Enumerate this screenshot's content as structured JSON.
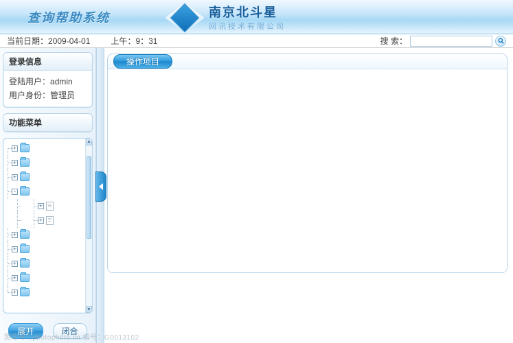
{
  "header": {
    "system_title": "查询帮助系统",
    "company_name": "南京北斗星",
    "company_sub": "网讯技术有限公司"
  },
  "info_bar": {
    "date_label": "当前日期",
    "date_value": "2009-04-01",
    "time_label": "上午",
    "time_value": "9：31",
    "search_label": "搜 索",
    "search_value": ""
  },
  "sidebar": {
    "login_panel_title": "登录信息",
    "login_user_label": "登陆用户",
    "login_user_value": "admin",
    "login_role_label": "用户身份",
    "login_role_value": "管理员",
    "menu_panel_title": "功能菜单",
    "expand_btn": "展开",
    "collapse_btn": "闭合"
  },
  "tree": [
    {
      "type": "folder",
      "toggle": "+",
      "level": 0
    },
    {
      "type": "folder",
      "toggle": "+",
      "level": 0
    },
    {
      "type": "folder",
      "toggle": "+",
      "level": 0
    },
    {
      "type": "folder",
      "toggle": "-",
      "level": 0
    },
    {
      "type": "file",
      "toggle": "+",
      "level": 1
    },
    {
      "type": "file",
      "toggle": "+",
      "level": 1
    },
    {
      "type": "folder",
      "toggle": "+",
      "level": 0
    },
    {
      "type": "folder",
      "toggle": "+",
      "level": 0
    },
    {
      "type": "folder",
      "toggle": "+",
      "level": 0
    },
    {
      "type": "folder",
      "toggle": "+",
      "level": 0
    },
    {
      "type": "folder",
      "toggle": "+",
      "level": 0
    }
  ],
  "main": {
    "content_tab": "操作项目"
  },
  "watermark": "图库号 f.photophoto.cn  编号：G0013102"
}
